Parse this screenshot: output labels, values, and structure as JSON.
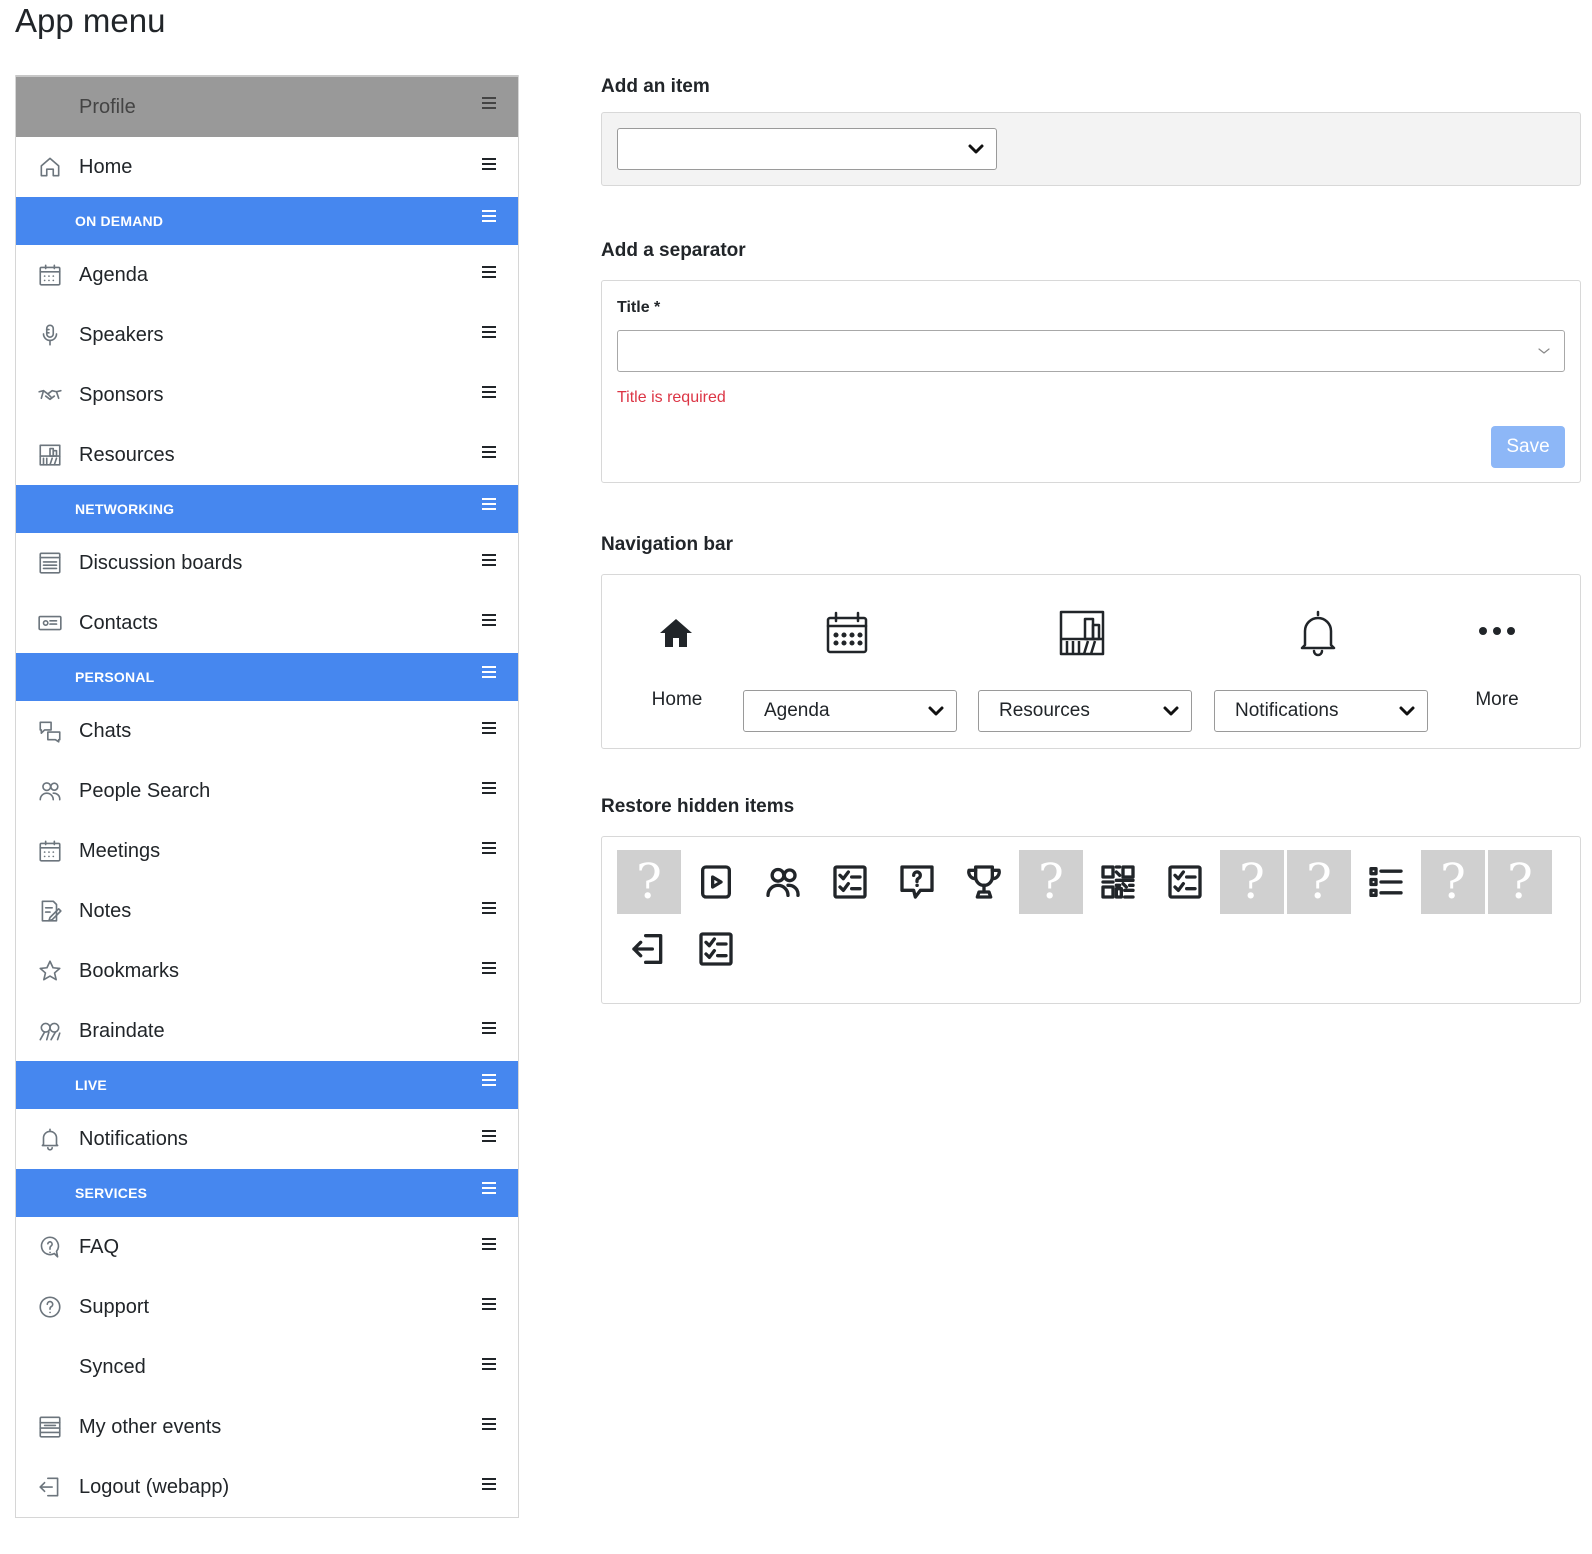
{
  "page": {
    "title": "App menu"
  },
  "menu": {
    "rows": [
      {
        "type": "profile",
        "label": "Profile",
        "icon": "none"
      },
      {
        "type": "item",
        "label": "Home",
        "icon": "home-icon"
      },
      {
        "type": "separator",
        "label": "ON DEMAND"
      },
      {
        "type": "item",
        "label": "Agenda",
        "icon": "calendar-icon"
      },
      {
        "type": "item",
        "label": "Speakers",
        "icon": "microphone-icon"
      },
      {
        "type": "item",
        "label": "Sponsors",
        "icon": "handshake-icon"
      },
      {
        "type": "item",
        "label": "Resources",
        "icon": "library-icon"
      },
      {
        "type": "separator",
        "label": "NETWORKING"
      },
      {
        "type": "item",
        "label": "Discussion boards",
        "icon": "board-icon"
      },
      {
        "type": "item",
        "label": "Contacts",
        "icon": "contact-card-icon"
      },
      {
        "type": "separator",
        "label": "PERSONAL"
      },
      {
        "type": "item",
        "label": "Chats",
        "icon": "chat-icon"
      },
      {
        "type": "item",
        "label": "People Search",
        "icon": "people-icon"
      },
      {
        "type": "item",
        "label": "Meetings",
        "icon": "calendar-icon"
      },
      {
        "type": "item",
        "label": "Notes",
        "icon": "notes-icon"
      },
      {
        "type": "item",
        "label": "Bookmarks",
        "icon": "star-icon"
      },
      {
        "type": "item",
        "label": "Braindate",
        "icon": "braindate-icon"
      },
      {
        "type": "separator",
        "label": "LIVE"
      },
      {
        "type": "item",
        "label": "Notifications",
        "icon": "bell-icon"
      },
      {
        "type": "separator",
        "label": "SERVICES"
      },
      {
        "type": "item",
        "label": "FAQ",
        "icon": "faq-icon"
      },
      {
        "type": "item",
        "label": "Support",
        "icon": "help-circle-icon"
      },
      {
        "type": "item",
        "label": "Synced",
        "icon": "none"
      },
      {
        "type": "item",
        "label": "My other events",
        "icon": "events-list-icon"
      },
      {
        "type": "item",
        "label": "Logout (webapp)",
        "icon": "logout-icon"
      }
    ]
  },
  "add_item": {
    "title": "Add an item",
    "select_value": ""
  },
  "add_separator": {
    "title": "Add a separator",
    "field_label": "Title *",
    "field_value": "",
    "error": "Title is required",
    "save_label": "Save"
  },
  "navigation_bar": {
    "title": "Navigation bar",
    "items": [
      {
        "label": "Home",
        "icon": "home-solid-icon",
        "kind": "fixed"
      },
      {
        "label": "Agenda",
        "icon": "calendar-icon",
        "kind": "select"
      },
      {
        "label": "Resources",
        "icon": "library-icon",
        "kind": "select"
      },
      {
        "label": "Notifications",
        "icon": "bell-icon",
        "kind": "select"
      },
      {
        "label": "More",
        "icon": "more-dots-icon",
        "kind": "fixed"
      }
    ]
  },
  "restore_hidden": {
    "title": "Restore hidden items",
    "items": [
      "unknown-icon",
      "video-icon",
      "people-icon",
      "checklist-icon",
      "question-chat-icon",
      "trophy-icon",
      "unknown-icon",
      "qr-code-icon",
      "checklist-icon",
      "unknown-icon",
      "unknown-icon",
      "list-icon",
      "unknown-icon",
      "unknown-icon",
      "logout-icon",
      "checklist-icon"
    ],
    "unknown_glyph": "?"
  },
  "colors": {
    "separator_blue": "#4687ef",
    "profile_grey": "#999999",
    "save_button_disabled": "#8db7f7",
    "error_red": "#dc3545"
  }
}
